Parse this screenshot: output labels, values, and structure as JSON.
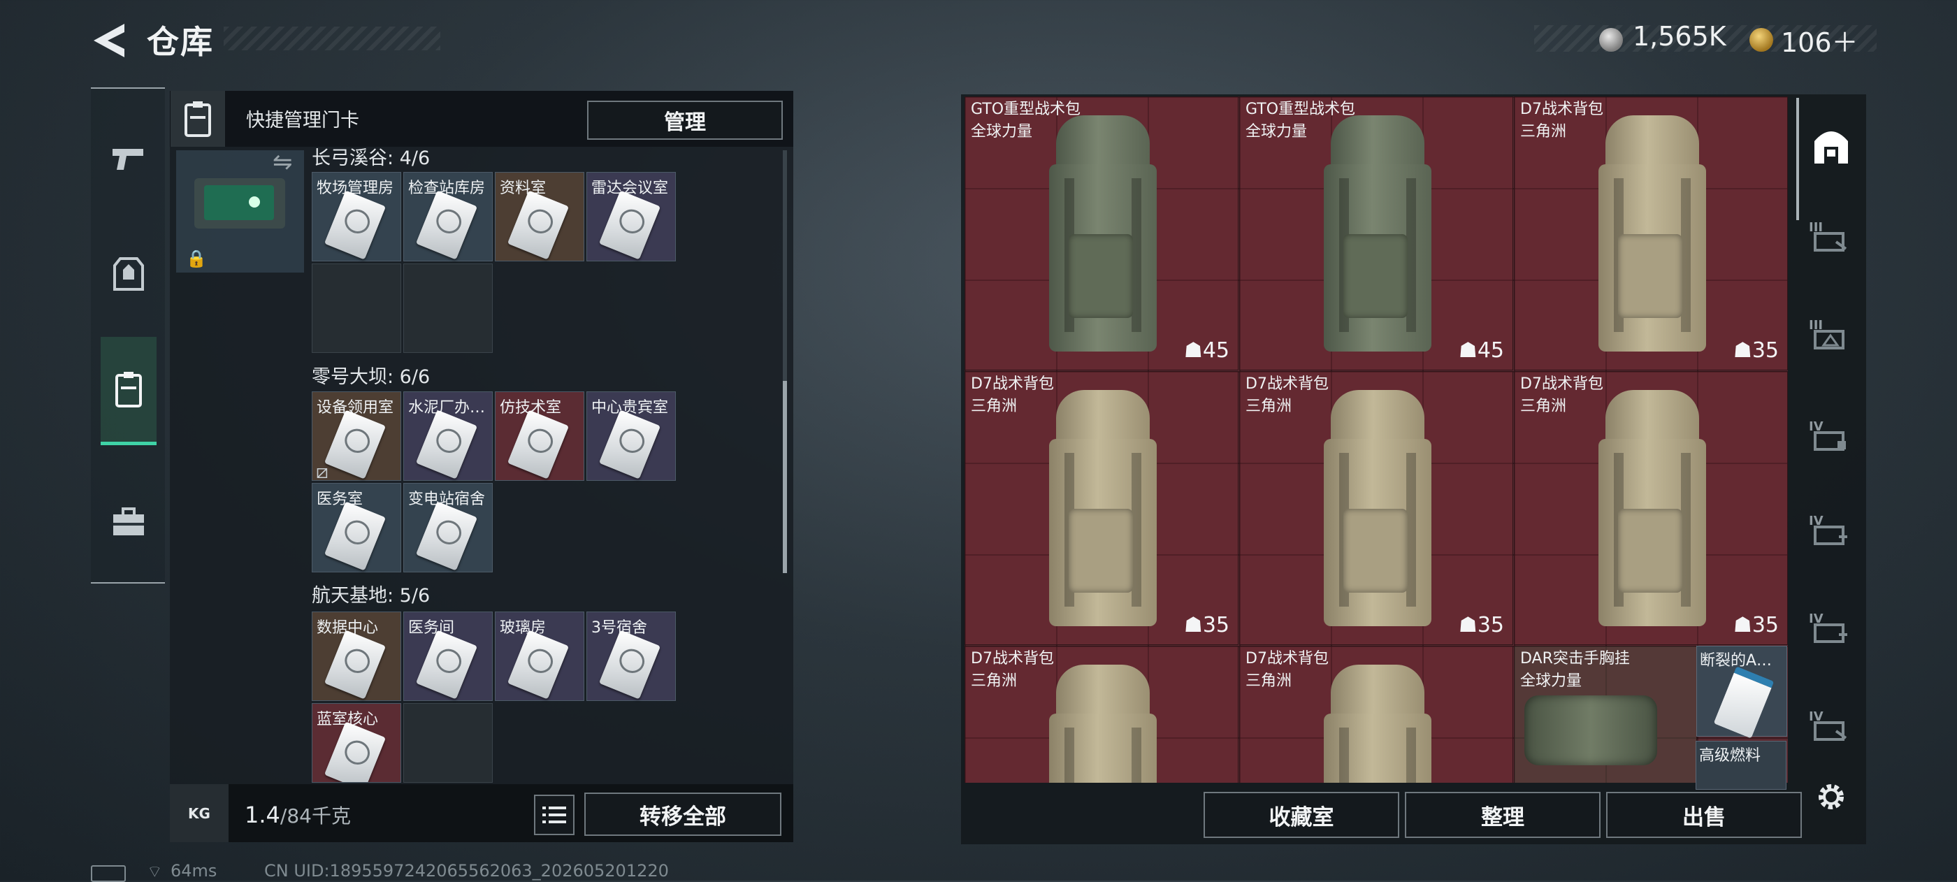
{
  "header": {
    "title": "仓库",
    "back_icon": "back-arrow-icon",
    "currency": [
      {
        "icon": "silver-coin-icon",
        "value": "1,565K"
      },
      {
        "icon": "triangle-coin-icon",
        "value": "106＋"
      }
    ]
  },
  "left_nav": {
    "items": [
      {
        "name": "weapons",
        "icon": "pistol-icon"
      },
      {
        "name": "equipment",
        "icon": "armor-icon"
      },
      {
        "name": "keycards",
        "icon": "keycard-icon",
        "active": true
      },
      {
        "name": "items",
        "icon": "briefcase-icon"
      }
    ]
  },
  "left_panel": {
    "header_label": "快捷管理门卡",
    "manage_label": "管理",
    "groups": [
      {
        "label": "长弓溪谷: 4/6",
        "cells": [
          "牧场管理房",
          "检查站库房",
          "资料室",
          "雷达会议室"
        ]
      },
      {
        "label": "零号大坝: 6/6",
        "cells": [
          "设备领用室",
          "水泥厂办…",
          "仿技术室",
          "中心贵宾室",
          "医务室",
          "变电站宿舍"
        ]
      },
      {
        "label": "航天基地: 5/6",
        "cells": [
          "数据中心",
          "医务间",
          "玻璃房",
          "3号宿舍",
          "蓝室核心"
        ]
      }
    ],
    "weight_value": "1.4",
    "weight_max": "/84千克",
    "weight_icon_label": "KG",
    "transfer_label": "转移全部"
  },
  "right_panel": {
    "items": [
      {
        "name": "GTO重型战术包",
        "sub": "全球力量",
        "count": "45",
        "kind": "gto"
      },
      {
        "name": "GTO重型战术包",
        "sub": "全球力量",
        "count": "45",
        "kind": "gto"
      },
      {
        "name": "D7战术背包",
        "sub": "三角洲",
        "count": "35",
        "kind": "d7"
      },
      {
        "name": "D7战术背包",
        "sub": "三角洲",
        "count": "35",
        "kind": "d7"
      },
      {
        "name": "D7战术背包",
        "sub": "三角洲",
        "count": "35",
        "kind": "d7"
      },
      {
        "name": "D7战术背包",
        "sub": "三角洲",
        "count": "35",
        "kind": "d7"
      },
      {
        "name": "D7战术背包",
        "sub": "三角洲",
        "count": "",
        "kind": "d7"
      },
      {
        "name": "D7战术背包",
        "sub": "三角洲",
        "count": "",
        "kind": "d7"
      },
      {
        "name": "DAR突击手胸挂",
        "sub": "全球力量",
        "count": "",
        "kind": "rig"
      }
    ],
    "small_items": [
      {
        "name": "断裂的A…"
      },
      {
        "name": "高级燃料"
      }
    ],
    "buttons": [
      "收藏室",
      "整理",
      "出售"
    ]
  },
  "right_rail": {
    "items": [
      {
        "icon": "stash-home-icon",
        "tier": ""
      },
      {
        "icon": "expand-slot-icon",
        "tier": "III"
      },
      {
        "icon": "expand-slot-icon",
        "tier": "III"
      },
      {
        "icon": "expand-slot-icon",
        "tier": "IV"
      },
      {
        "icon": "expand-slot-icon",
        "tier": "IV"
      },
      {
        "icon": "expand-slot-icon",
        "tier": "IV"
      },
      {
        "icon": "expand-slot-icon",
        "tier": "IV"
      }
    ],
    "settings_icon": "gear-icon"
  },
  "status_bar": {
    "ping": "64ms",
    "uid": "CN UID:1895597242065562063_202605201220"
  },
  "colors": {
    "accent": "#3fd3a6",
    "item_bg": "#5a2a31",
    "panel_bg": "#181e23"
  }
}
